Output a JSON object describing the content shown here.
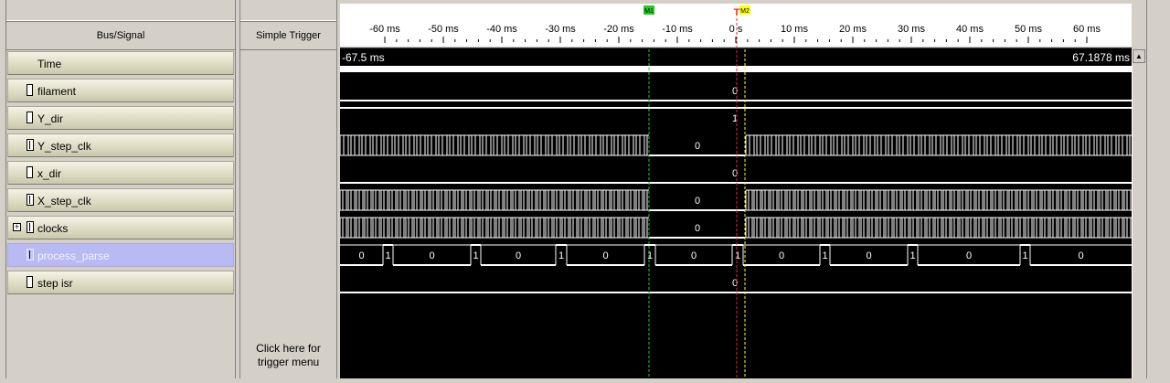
{
  "columns": {
    "bus_signal": "Bus/Signal",
    "trigger": "Simple Trigger"
  },
  "trigger_hint": [
    "Click here for",
    "trigger menu"
  ],
  "time_row": {
    "label": "Time",
    "start": "-67.5 ms",
    "end": "67.1878 ms"
  },
  "ruler_ticks": [
    "-60 ms",
    "-50 ms",
    "-40 ms",
    "-30 ms",
    "-20 ms",
    "-10 ms",
    "0 s",
    "10 ms",
    "20 ms",
    "30 ms",
    "40 ms",
    "50 ms",
    "60 ms"
  ],
  "markers": {
    "m1": "M1",
    "m2": "M2",
    "trigger": "T"
  },
  "signals": [
    {
      "name": "filament",
      "kind": "bit",
      "value": "0"
    },
    {
      "name": "Y_dir",
      "kind": "bit",
      "value": "1"
    },
    {
      "name": "Y_step_clk",
      "kind": "bus",
      "value": "0"
    },
    {
      "name": "x_dir",
      "kind": "bit",
      "value": "0"
    },
    {
      "name": "X_step_clk",
      "kind": "bus",
      "value": "0"
    },
    {
      "name": "clocks",
      "kind": "bus",
      "value": "0",
      "expandable": true
    },
    {
      "name": "process_parse",
      "kind": "bus",
      "selected": true,
      "values": [
        "0",
        "1",
        "0",
        "1",
        "0",
        "1",
        "0",
        "1",
        "0",
        "1",
        "0",
        "1",
        "0",
        "1",
        "0",
        "1",
        "0"
      ]
    },
    {
      "name": "step isr",
      "kind": "bit",
      "value": "0"
    }
  ],
  "colors": {
    "m1": "#22cc22",
    "m2": "#ffff00",
    "trigger": "#ff2020",
    "selected_row": "#b9b9f4"
  }
}
